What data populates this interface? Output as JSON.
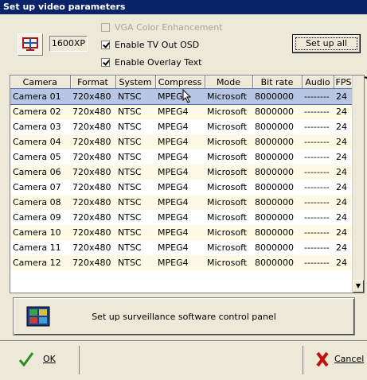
{
  "window": {
    "title": "Set up video parameters"
  },
  "resolution": {
    "label": "1600XP"
  },
  "options": {
    "vga_color": "VGA Color Enhancement",
    "tv_out_osd": "Enable TV Out OSD",
    "overlay_text": "Enable Overlay Text"
  },
  "buttons": {
    "setup_all": "Set up all",
    "panel": "Set up surveillance software control panel",
    "ok": "OK",
    "cancel": "Cancel"
  },
  "table": {
    "headers": [
      "Camera",
      "Format",
      "System",
      "Compress",
      "Mode",
      "Bit rate",
      "Audio",
      "FPS"
    ],
    "rows": [
      [
        "Camera 01",
        "720x480",
        "NTSC",
        "MPEG4",
        "Microsoft",
        "8000000",
        "--------",
        "24"
      ],
      [
        "Camera 02",
        "720x480",
        "NTSC",
        "MPEG4",
        "Microsoft",
        "8000000",
        "--------",
        "24"
      ],
      [
        "Camera 03",
        "720x480",
        "NTSC",
        "MPEG4",
        "Microsoft",
        "8000000",
        "--------",
        "24"
      ],
      [
        "Camera 04",
        "720x480",
        "NTSC",
        "MPEG4",
        "Microsoft",
        "8000000",
        "--------",
        "24"
      ],
      [
        "Camera 05",
        "720x480",
        "NTSC",
        "MPEG4",
        "Microsoft",
        "8000000",
        "--------",
        "24"
      ],
      [
        "Camera 06",
        "720x480",
        "NTSC",
        "MPEG4",
        "Microsoft",
        "8000000",
        "--------",
        "24"
      ],
      [
        "Camera 07",
        "720x480",
        "NTSC",
        "MPEG4",
        "Microsoft",
        "8000000",
        "--------",
        "24"
      ],
      [
        "Camera 08",
        "720x480",
        "NTSC",
        "MPEG4",
        "Microsoft",
        "8000000",
        "--------",
        "24"
      ],
      [
        "Camera 09",
        "720x480",
        "NTSC",
        "MPEG4",
        "Microsoft",
        "8000000",
        "--------",
        "24"
      ],
      [
        "Camera 10",
        "720x480",
        "NTSC",
        "MPEG4",
        "Microsoft",
        "8000000",
        "--------",
        "24"
      ],
      [
        "Camera 11",
        "720x480",
        "NTSC",
        "MPEG4",
        "Microsoft",
        "8000000",
        "--------",
        "24"
      ],
      [
        "Camera 12",
        "720x480",
        "NTSC",
        "MPEG4",
        "Microsoft",
        "8000000",
        "--------",
        "24"
      ]
    ]
  }
}
